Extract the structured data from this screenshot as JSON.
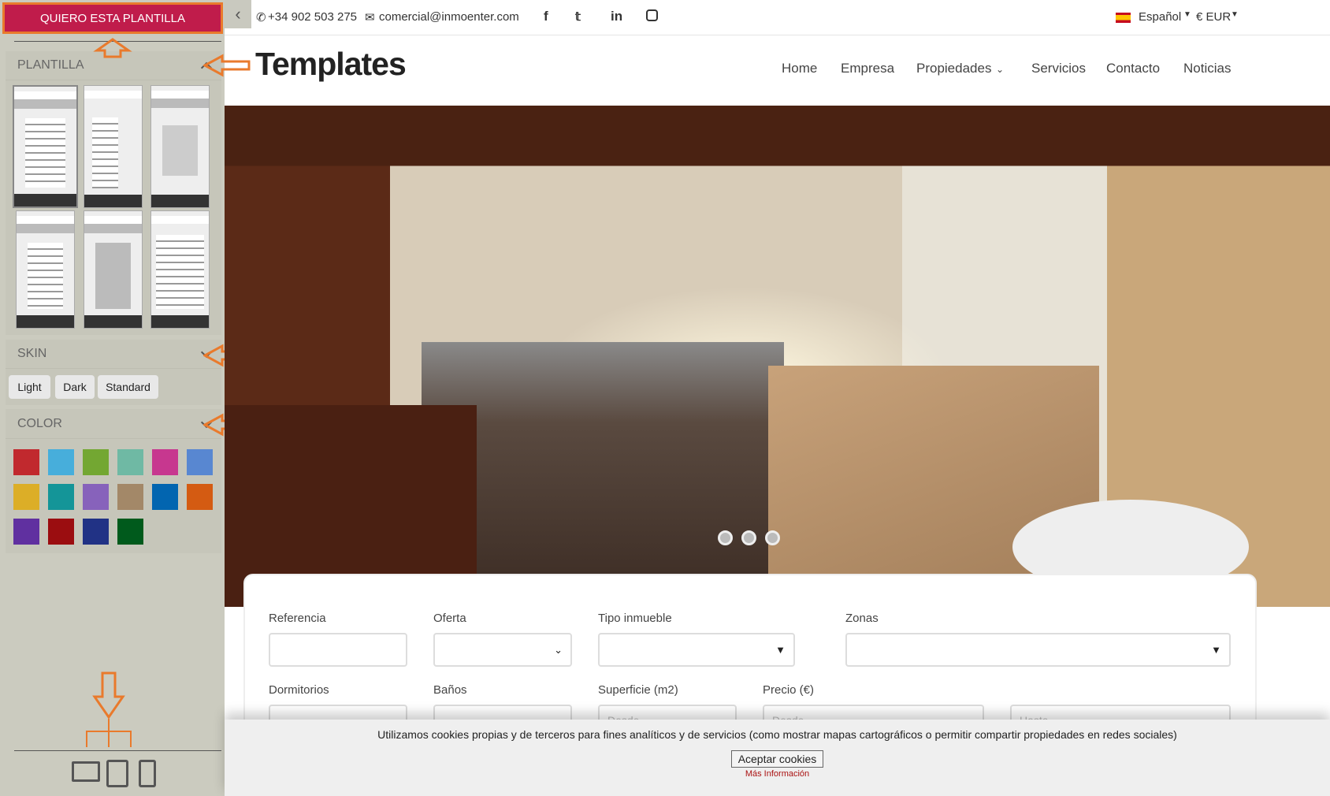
{
  "sidebar": {
    "cta": "QUIERO ESTA PLANTILLA",
    "plantilla": "PLANTILLA",
    "skin": "SKIN",
    "skins": [
      "Light",
      "Dark",
      "Standard"
    ],
    "color": "COLOR",
    "colors": [
      "#c1292e",
      "#47aedb",
      "#73a732",
      "#6fb9a4",
      "#c7378f",
      "#5887d1",
      "#dcae27",
      "#149598",
      "#8762bb",
      "#a38868",
      "#0265b0",
      "#d45b12",
      "#6030a0",
      "#9b0d10",
      "#213285",
      "#005a1c"
    ],
    "devices": [
      "desktop-icon",
      "tablet-icon",
      "mobile-icon"
    ]
  },
  "topbar": {
    "phone": "+34 902 503 275",
    "email": "comercial@inmoenter.com",
    "social": [
      "f",
      "t",
      "in",
      "ig"
    ],
    "language": "Español",
    "currency": "€ EUR"
  },
  "header": {
    "logo": "Templates",
    "nav": [
      "Home",
      "Empresa",
      "Propiedades",
      "Servicios",
      "Contacto",
      "Noticias"
    ]
  },
  "slider": {
    "dots": 3,
    "active": 0
  },
  "search": {
    "referencia": "Referencia",
    "oferta": "Oferta",
    "tipo": "Tipo inmueble",
    "zonas": "Zonas",
    "dormitorios": "Dormitorios",
    "banos": "Baños",
    "superficie": "Superficie (m2)",
    "precio": "Precio (€)",
    "desde": "Desde",
    "hasta": "Hasta"
  },
  "cookie": {
    "text": "Utilizamos cookies propias y de terceros para fines analíticos y de servicios (como mostrar mapas cartográficos o permitir compartir propiedades en redes sociales)",
    "accept": "Aceptar cookies",
    "more": "Más Información"
  },
  "colors": {
    "accent": "#c01c4b",
    "annotation": "#e97a2c"
  }
}
